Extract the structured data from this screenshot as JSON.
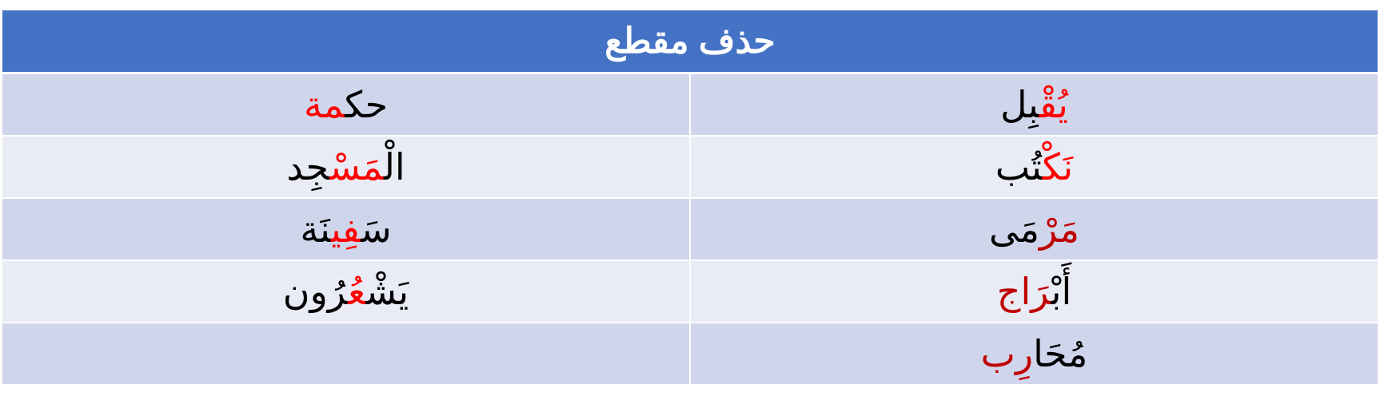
{
  "table": {
    "title": "حذف مقطع",
    "rows": [
      {
        "right": [
          {
            "text": "يُ",
            "color": "red"
          },
          {
            "text": "قْ",
            "color": "red"
          },
          {
            "text": "بِل",
            "color": "black"
          }
        ],
        "left": [
          {
            "text": "حك",
            "color": "black"
          },
          {
            "text": "مة",
            "color": "red"
          }
        ]
      },
      {
        "right": [
          {
            "text": "نَ",
            "color": "red"
          },
          {
            "text": "كْ",
            "color": "red"
          },
          {
            "text": "تُب",
            "color": "black"
          }
        ],
        "left": [
          {
            "text": "الْ",
            "color": "black"
          },
          {
            "text": "مَسْ",
            "color": "red"
          },
          {
            "text": "جِد",
            "color": "black"
          }
        ]
      },
      {
        "right": [
          {
            "text": "مَرْ",
            "color": "darkred"
          },
          {
            "text": "مَى",
            "color": "black"
          }
        ],
        "left": [
          {
            "text": "سَ",
            "color": "black"
          },
          {
            "text": "فِي",
            "color": "red"
          },
          {
            "text": "نَة",
            "color": "black"
          }
        ]
      },
      {
        "right": [
          {
            "text": "أَبْ",
            "color": "black"
          },
          {
            "text": "رَاج",
            "color": "darkred"
          }
        ],
        "left": [
          {
            "text": "يَشْ",
            "color": "black"
          },
          {
            "text": "عُ",
            "color": "red"
          },
          {
            "text": "رُون",
            "color": "black"
          }
        ]
      },
      {
        "right": [
          {
            "text": "مُحَا",
            "color": "black"
          },
          {
            "text": "رِب",
            "color": "darkred"
          }
        ],
        "left": []
      }
    ]
  },
  "colors": {
    "header_bg": "#4472c4",
    "row_dark": "#cfd5ea",
    "row_light": "#e9ebf5",
    "black": "#000000",
    "red": "#ff0000",
    "darkred": "#c00000"
  }
}
